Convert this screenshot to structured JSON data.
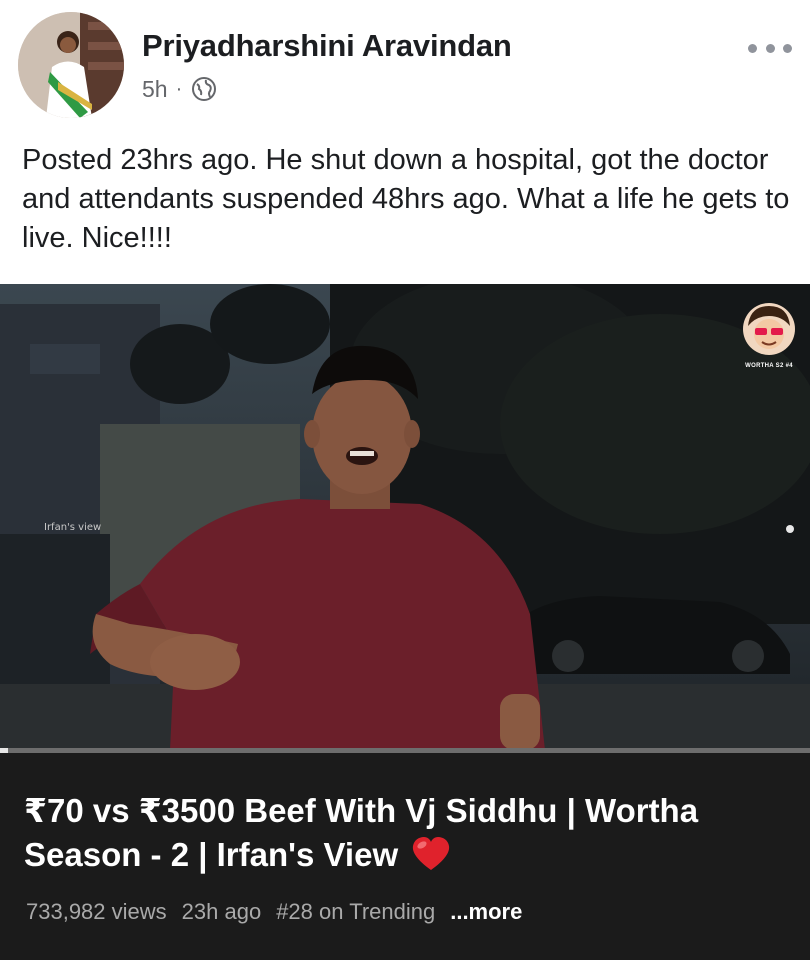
{
  "post": {
    "author": "Priyadharshini Aravindan",
    "time": "5h",
    "separator": "·",
    "privacy_icon": "globe-icon",
    "menu_icon": "more-options-icon",
    "text": "Posted 23hrs ago. He shut down a hospital, got the doctor and attendants suspended 48hrs ago. What a life he gets to live. Nice!!!!"
  },
  "video": {
    "watermark": "Irfan's view",
    "channel_tag": "WORTHA S2 #4",
    "progress": 0.01,
    "title": "₹70 vs ₹3500 Beef With Vj Siddhu | Wortha Season - 2 | Irfan's View",
    "title_icon": "heart-icon",
    "views": "733,982 views",
    "age": "23h ago",
    "trending": "#28 on Trending",
    "more_label": "...more"
  },
  "colors": {
    "name": "#1c1e21",
    "meta": "#65676b",
    "info_bg": "#1b1b1b",
    "heart": "#e0222c"
  }
}
